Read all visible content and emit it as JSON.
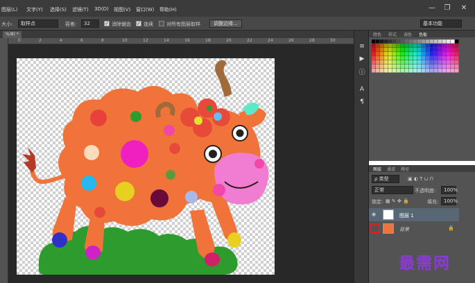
{
  "menubar": {
    "items": [
      "图层(L)",
      "文字(Y)",
      "选择(S)",
      "滤镜(T)",
      "3D(D)",
      "视图(V)",
      "窗口(W)",
      "帮助(H)"
    ],
    "min_label": "—",
    "restore_label": "❐",
    "close_label": "✕"
  },
  "options": {
    "size_label": "大小:",
    "size_value": "取样点",
    "tolerance_label": "容差:",
    "tolerance_value": "32",
    "antialias_label": "消除锯齿",
    "contiguous_label": "连续",
    "sample_all_label": "对所有图层取样",
    "refine_button": "调整边缘...",
    "workspace_value": "基本功能"
  },
  "document": {
    "tab_label": "%/8) *",
    "ruler_h": [
      "0",
      "2",
      "4",
      "6",
      "8",
      "10",
      "12",
      "14",
      "16",
      "18",
      "20",
      "22",
      "24",
      "26",
      "28",
      "30"
    ]
  },
  "panels": {
    "swatch_tabs": [
      "颜色",
      "样式",
      "调色",
      "色板"
    ],
    "layer_tabs": [
      "图层",
      "通道",
      "路径"
    ],
    "kind_filter": "ρ 类型",
    "blend_mode": "正常",
    "opacity_label": "不透明度:",
    "opacity_value": "100%",
    "lock_label": "锁定:",
    "fill_label": "填充:",
    "fill_value": "100%",
    "layers": [
      {
        "name": "图层 1",
        "visible_icon": "eye-icon"
      },
      {
        "name": "背景",
        "visible_icon": "eye-icon"
      }
    ]
  },
  "watermark": "最需网",
  "colors": {
    "accent_selection": "#586776",
    "body_orange": "#f0733a",
    "grass_green": "#2e9b2e",
    "face_pink": "#f07dd0"
  }
}
